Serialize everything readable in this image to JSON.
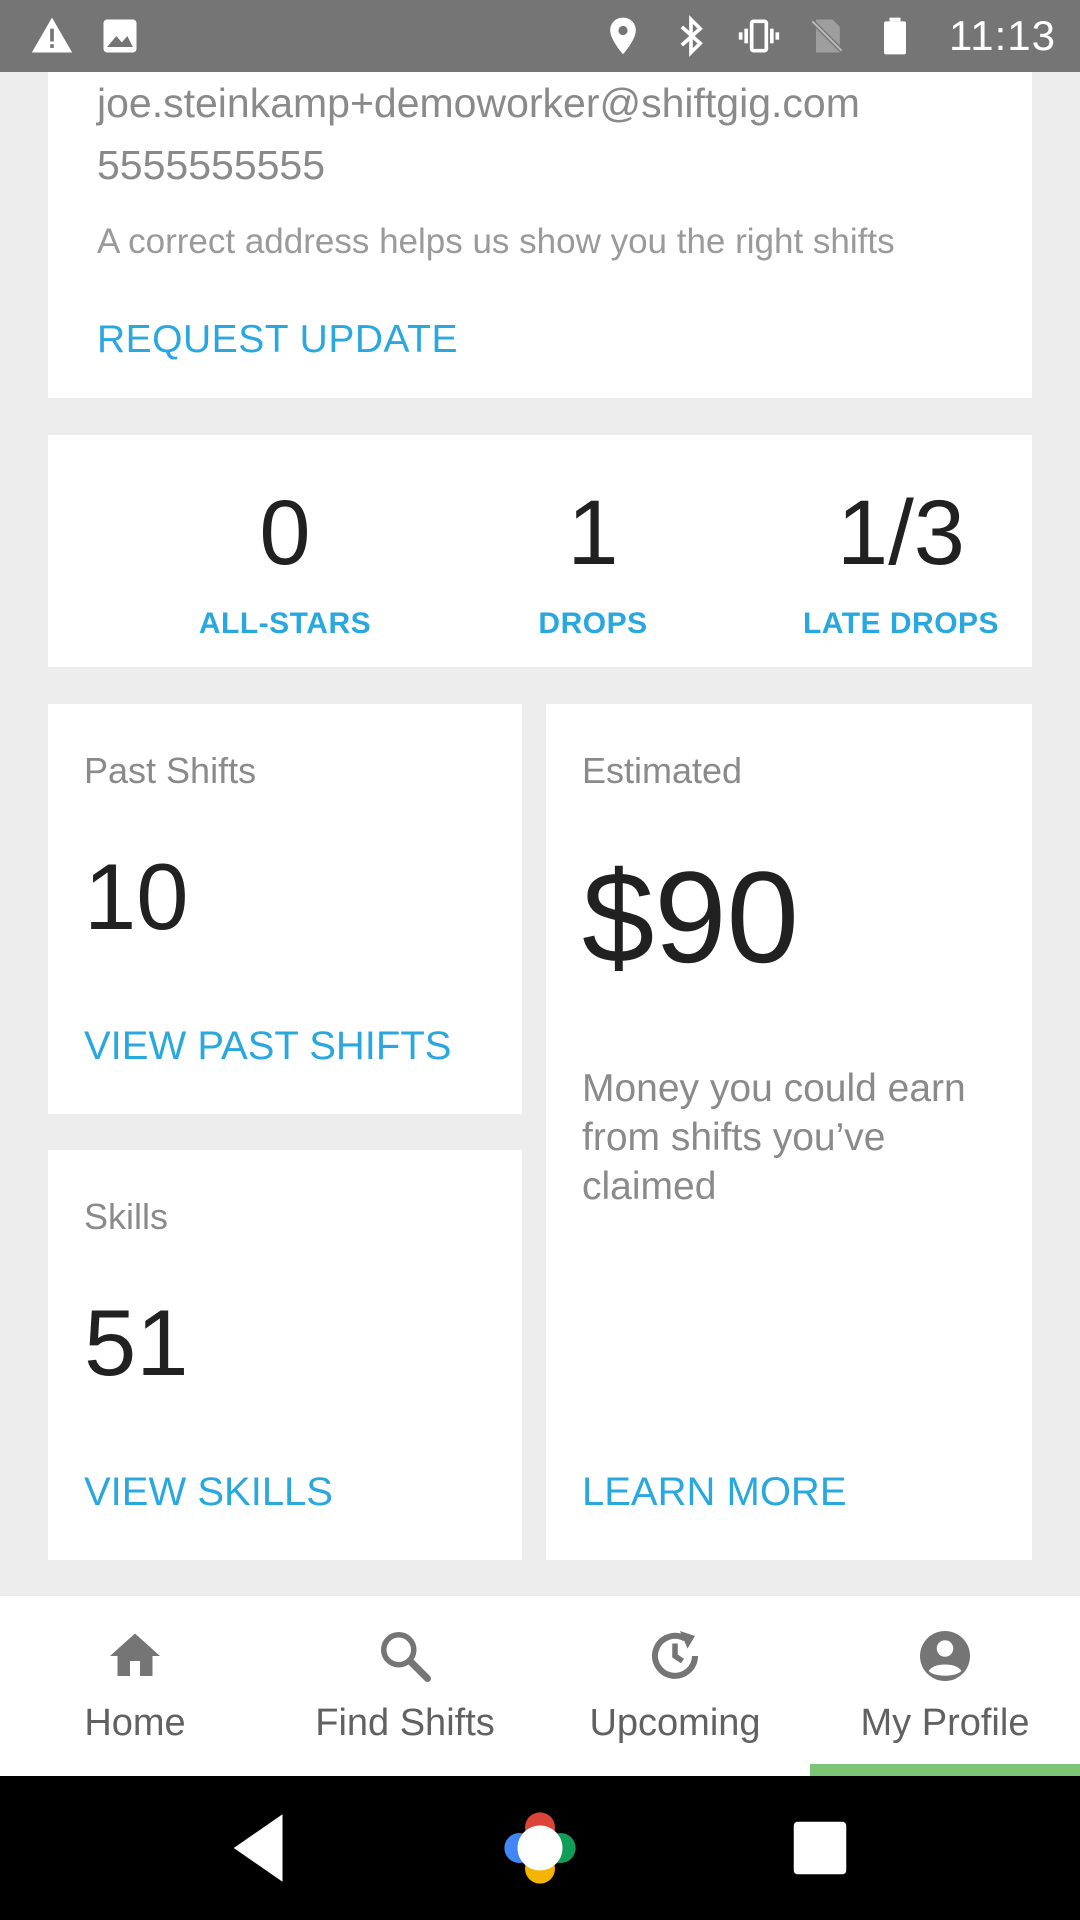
{
  "status_bar": {
    "time": "11:13",
    "left_icons": [
      "warning-icon",
      "image-icon"
    ],
    "right_icons": [
      "location-icon",
      "bluetooth-icon",
      "vibrate-icon",
      "no-sim-icon",
      "battery-icon"
    ]
  },
  "contact": {
    "email": "joe.steinkamp+demoworker@shiftgig.com",
    "phone": "5555555555",
    "hint": "A correct address helps us show you the right shifts",
    "request_update_label": "REQUEST UPDATE"
  },
  "stats": [
    {
      "value": "0",
      "label": "ALL-STARS"
    },
    {
      "value": "1",
      "label": "DROPS"
    },
    {
      "value": "1/3",
      "label": "LATE DROPS"
    }
  ],
  "past_shifts": {
    "label": "Past Shifts",
    "value": "10",
    "link_label": "VIEW PAST SHIFTS"
  },
  "skills": {
    "label": "Skills",
    "value": "51",
    "link_label": "VIEW SKILLS"
  },
  "estimated": {
    "label": "Estimated",
    "amount": "$90",
    "description": "Money you could earn from shifts you’ve claimed",
    "link_label": "LEARN MORE"
  },
  "bottom_nav": {
    "items": [
      {
        "label": "Home",
        "icon": "home-icon"
      },
      {
        "label": "Find Shifts",
        "icon": "search-icon"
      },
      {
        "label": "Upcoming",
        "icon": "clock-refresh-icon"
      },
      {
        "label": "My Profile",
        "icon": "profile-icon"
      }
    ],
    "active_index": 3,
    "active_color": "#7cc576"
  },
  "colors": {
    "accent": "#29a8e0",
    "status_bar": "#757575",
    "background": "#ededed"
  }
}
